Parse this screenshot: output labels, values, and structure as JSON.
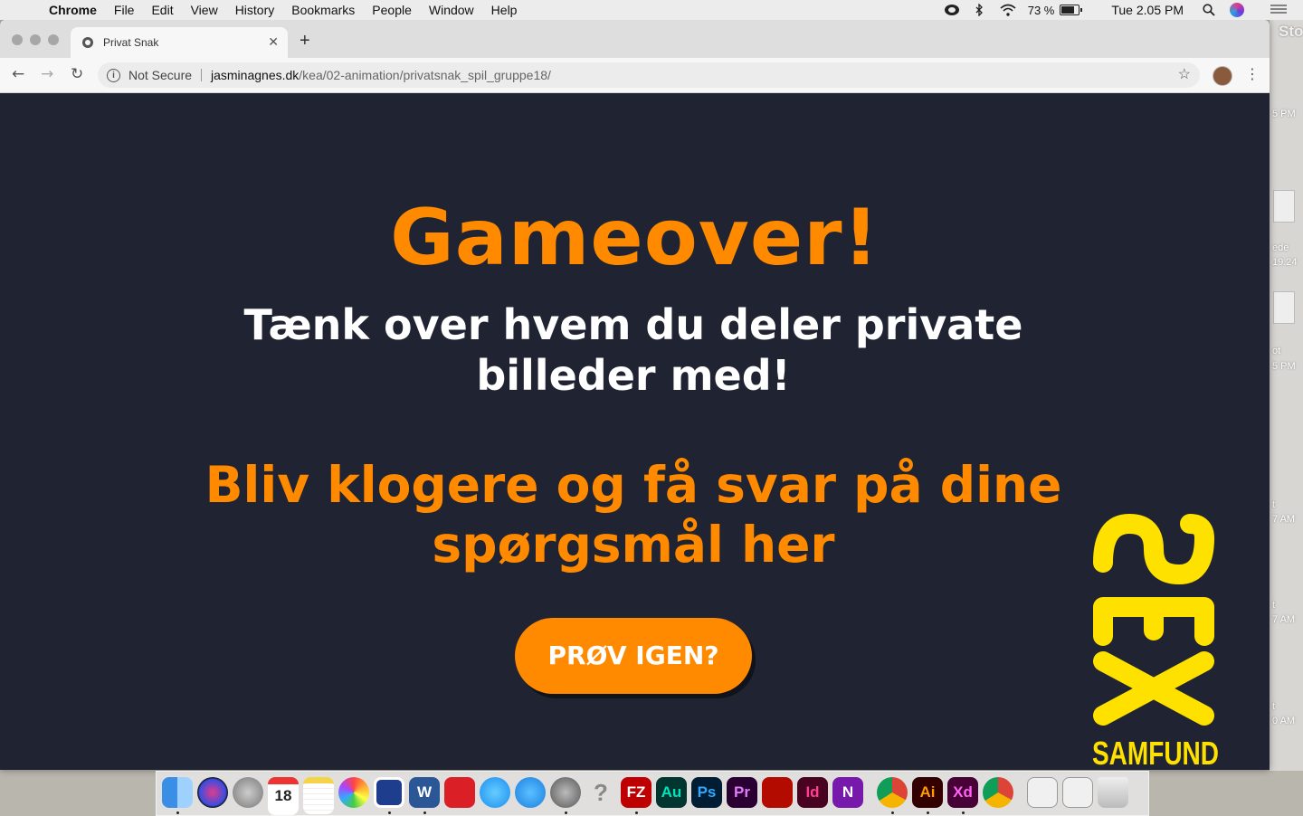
{
  "menubar": {
    "app_name": "Chrome",
    "items": [
      "File",
      "Edit",
      "View",
      "History",
      "Bookmarks",
      "People",
      "Window",
      "Help"
    ],
    "battery": "73 %",
    "clock": "Tue 2.05 PM"
  },
  "desktop": {
    "labels": [
      "Sto",
      "5 PM",
      "ede",
      "19.24",
      "ot",
      "5 PM",
      "t",
      "7 AM",
      "t",
      "7 AM",
      "t",
      "0 AM"
    ]
  },
  "browser": {
    "tab_title": "Privat Snak",
    "tab_close": "✕",
    "new_tab": "+",
    "security_label": "Not Secure",
    "url_host": "jasminagnes.dk",
    "url_path": "/kea/02-animation/privatsnak_spil_gruppe18/"
  },
  "page": {
    "heading": "Gameover!",
    "subheading": "Tænk over hvem du deler private billeder med!",
    "link_text": "Bliv klogere og få svar på dine spørgsmål her",
    "retry_button": "PRØV IGEN?",
    "logo_text": "SEX",
    "logo_subtext": "SAMFUND"
  },
  "colors": {
    "page_background": "#1f2332",
    "accent": "#ff8a00",
    "logo": "#ffe100",
    "heading_text": "#ffffff"
  },
  "dock": {
    "apps": [
      {
        "name": "finder-icon",
        "label": ""
      },
      {
        "name": "siri-icon",
        "label": ""
      },
      {
        "name": "launchpad-icon",
        "label": ""
      },
      {
        "name": "calendar-icon",
        "label": "18"
      },
      {
        "name": "notes-icon",
        "label": ""
      },
      {
        "name": "photos-icon",
        "label": ""
      },
      {
        "name": "sourcetree-icon",
        "label": ""
      },
      {
        "name": "word-icon",
        "label": "W"
      },
      {
        "name": "creative-cloud-icon",
        "label": ""
      },
      {
        "name": "messages-icon",
        "label": ""
      },
      {
        "name": "app-store-icon",
        "label": ""
      },
      {
        "name": "system-preferences-icon",
        "label": ""
      },
      {
        "name": "help-icon",
        "label": "?"
      },
      {
        "name": "filezilla-icon",
        "label": "FZ"
      },
      {
        "name": "audition-icon",
        "label": "Au"
      },
      {
        "name": "photoshop-icon",
        "label": "Ps"
      },
      {
        "name": "premiere-icon",
        "label": "Pr"
      },
      {
        "name": "acrobat-icon",
        "label": ""
      },
      {
        "name": "indesign-icon",
        "label": "Id"
      },
      {
        "name": "onenote-icon",
        "label": "N"
      },
      {
        "name": "chrome-icon",
        "label": ""
      },
      {
        "name": "illustrator-icon",
        "label": "Ai"
      },
      {
        "name": "xd-icon",
        "label": "Xd"
      },
      {
        "name": "chrome-canary-icon",
        "label": ""
      },
      {
        "name": "illustrator-doc-icon",
        "label": ""
      },
      {
        "name": "xd-doc-icon",
        "label": ""
      },
      {
        "name": "trash-icon",
        "label": ""
      }
    ]
  }
}
